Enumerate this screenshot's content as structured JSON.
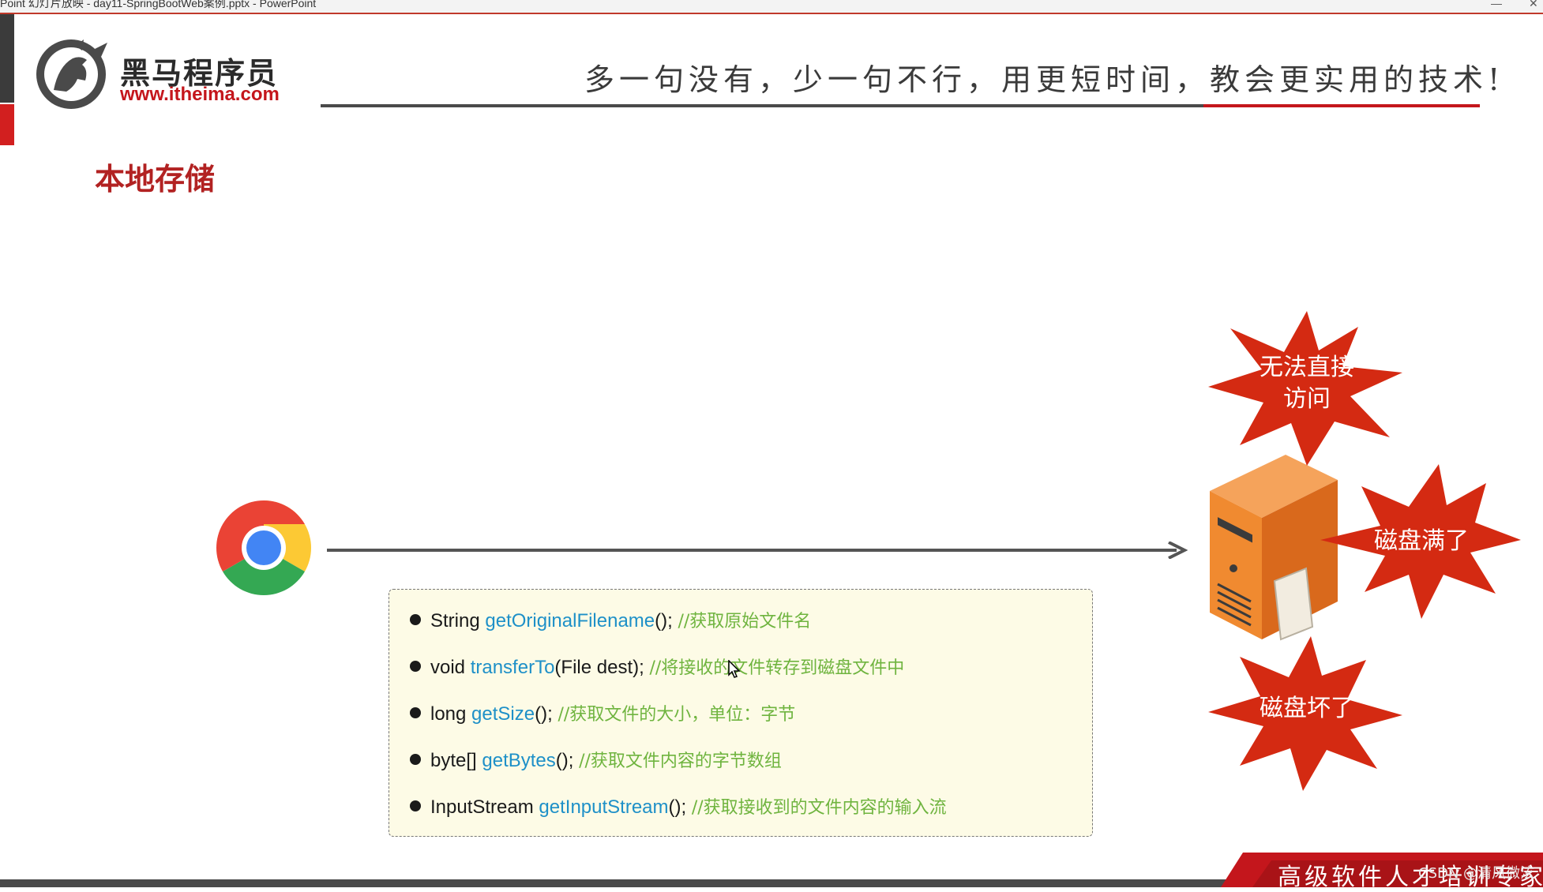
{
  "window": {
    "title": "Point 幻灯片放映 - day11-SpringBootWeb案例.pptx - PowerPoint"
  },
  "header": {
    "brand_cn": "黑马程序员",
    "brand_url": "www.itheima.com",
    "slogan": "多一句没有，少一句不行，用更短时间，教会更实用的技术!"
  },
  "slide": {
    "title": "本地存储",
    "bursts": [
      {
        "line1": "无法直接",
        "line2": "访问"
      },
      {
        "line1": "磁盘满了",
        "line2": ""
      },
      {
        "line1": "磁盘坏了",
        "line2": ""
      }
    ],
    "methods": [
      {
        "type": "String",
        "name": "getOriginalFilename",
        "args": "();",
        "comment": "//获取原始文件名"
      },
      {
        "type": "void",
        "name": "transferTo",
        "args": "(File dest);",
        "comment": "//将接收的文件转存到磁盘文件中"
      },
      {
        "type": "long",
        "name": "getSize",
        "args": "();",
        "comment": "//获取文件的大小，单位：字节"
      },
      {
        "type": "byte[]",
        "name": "getBytes",
        "args": "();",
        "comment": "//获取文件内容的字节数组"
      },
      {
        "type": "InputStream",
        "name": "getInputStream",
        "args": "();",
        "comment": "//获取接收到的文件内容的输入流"
      }
    ]
  },
  "footer": {
    "text": "高级软件人才培训专家",
    "watermark": "CSDN @清风微泫"
  },
  "colors": {
    "accent_red": "#c4161c",
    "method_blue": "#1e90c8",
    "comment_green": "#6fb43f",
    "code_bg": "#fdfbe6"
  }
}
